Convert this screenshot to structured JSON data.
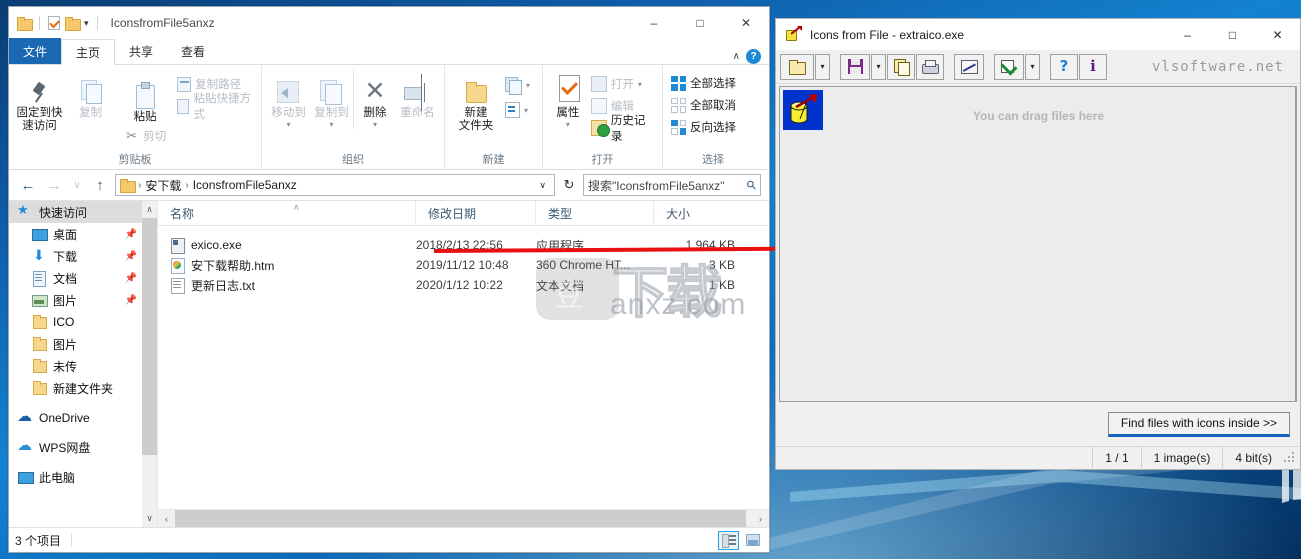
{
  "explorer": {
    "title": "IconsfromFile5anxz",
    "quick_access_toolbar": [
      {
        "name": "folder-icon",
        "label": "文件夹"
      },
      {
        "name": "properties-icon",
        "label": "属性"
      },
      {
        "name": "new-folder-icon",
        "label": "新建文件夹"
      },
      {
        "name": "customize-caret",
        "label": "▾"
      }
    ],
    "window_buttons": {
      "minimize": "–",
      "maximize": "□",
      "close": "✕"
    },
    "tabs": [
      {
        "label": "文件",
        "state": "file"
      },
      {
        "label": "主页",
        "state": "active"
      },
      {
        "label": "共享",
        "state": "normal"
      },
      {
        "label": "查看",
        "state": "normal"
      }
    ],
    "ribbon_collapse": "∧",
    "help_label": "?",
    "ribbon": {
      "clipboard": {
        "group_label": "剪贴板",
        "pin": "固定到快速访问",
        "pin_line1": "固定到快",
        "pin_line2": "速访问",
        "copy": "复制",
        "paste": "粘贴",
        "cut": "剪切",
        "copy_path": "复制路径",
        "paste_shortcut": "粘贴快捷方式"
      },
      "organize": {
        "group_label": "组织",
        "move_to": "移动到",
        "copy_to": "复制到",
        "delete": "删除",
        "rename": "重命名"
      },
      "new": {
        "group_label": "新建",
        "new_folder_line1": "新建",
        "new_folder_line2": "文件夹"
      },
      "open": {
        "group_label": "打开",
        "properties": "属性",
        "open": "打开",
        "edit": "编辑",
        "history": "历史记录"
      },
      "select": {
        "group_label": "选择",
        "select_all": "全部选择",
        "select_none": "全部取消",
        "invert": "反向选择"
      }
    },
    "address": {
      "back": "←",
      "forward": "→",
      "recent": "∨",
      "up": "↑",
      "crumbs": [
        "安下载",
        "IconsfromFile5anxz"
      ],
      "separator": "›",
      "dropdown": "∨",
      "refresh": "↻"
    },
    "search": {
      "value": "搜索\"IconsfromFile5anxz\"",
      "icon": "⚲"
    },
    "nav_pane": [
      {
        "label": "快速访问",
        "icon": "star-icon",
        "level": 0,
        "selected": true,
        "pinned": false
      },
      {
        "label": "桌面",
        "icon": "desktop-icon",
        "level": 1,
        "selected": false,
        "pinned": true
      },
      {
        "label": "下载",
        "icon": "download-icon",
        "level": 1,
        "selected": false,
        "pinned": true
      },
      {
        "label": "文档",
        "icon": "document-icon",
        "level": 1,
        "selected": false,
        "pinned": true
      },
      {
        "label": "图片",
        "icon": "picture-icon",
        "level": 1,
        "selected": false,
        "pinned": true
      },
      {
        "label": "ICO",
        "icon": "folder-icon",
        "level": 1,
        "selected": false,
        "pinned": false
      },
      {
        "label": "图片",
        "icon": "folder-icon",
        "level": 1,
        "selected": false,
        "pinned": false
      },
      {
        "label": "未传",
        "icon": "folder-icon",
        "level": 1,
        "selected": false,
        "pinned": false
      },
      {
        "label": "新建文件夹",
        "icon": "folder-icon",
        "level": 1,
        "selected": false,
        "pinned": false
      },
      {
        "label": "OneDrive",
        "icon": "onedrive-icon",
        "level": 0,
        "selected": false,
        "pinned": false
      },
      {
        "label": "WPS网盘",
        "icon": "wps-cloud-icon",
        "level": 0,
        "selected": false,
        "pinned": false
      },
      {
        "label": "此电脑",
        "icon": "this-pc-icon",
        "level": 0,
        "selected": false,
        "pinned": false
      }
    ],
    "columns": [
      {
        "key": "name",
        "label": "名称",
        "sorted": true,
        "sort_caret": "∧"
      },
      {
        "key": "date",
        "label": "修改日期"
      },
      {
        "key": "type",
        "label": "类型"
      },
      {
        "key": "size",
        "label": "大小"
      }
    ],
    "files": [
      {
        "name": "exico.exe",
        "icon": "exe-file-icon",
        "date": "2018/2/13 22:56",
        "type": "应用程序",
        "size": "1,964 KB"
      },
      {
        "name": "安下载帮助.htm",
        "icon": "html-file-icon",
        "date": "2019/11/12 10:48",
        "type": "360 Chrome HT...",
        "size": "3 KB"
      },
      {
        "name": "更新日志.txt",
        "icon": "text-file-icon",
        "date": "2020/1/12 10:22",
        "type": "文本文档",
        "size": "1 KB"
      }
    ],
    "watermark": {
      "badge_glyph": "豆",
      "outline_text": "下载",
      "domain_text": "anxz.com"
    },
    "status": {
      "item_count": "3 个项目"
    },
    "view_buttons": [
      {
        "name": "details-view-button",
        "active": true
      },
      {
        "name": "thumbnail-view-button",
        "active": false
      }
    ],
    "hscroll": {
      "left": "‹",
      "right": "›"
    },
    "vscroll": {
      "up": "∨",
      "down": "∨"
    }
  },
  "extraico": {
    "title": "Icons from File - extraico.exe",
    "window_buttons": {
      "minimize": "–",
      "maximize": "□",
      "close": "✕"
    },
    "toolbar": [
      {
        "name": "open-file-button",
        "glyph": "open-folder-icon"
      },
      {
        "name": "open-dropdown-button",
        "glyph": "caret-down-icon",
        "label": "▾"
      },
      {
        "name": "save-button",
        "glyph": "floppy-save-icon"
      },
      {
        "name": "save-dropdown-button",
        "glyph": "caret-down-icon",
        "label": "▾"
      },
      {
        "name": "copy-button",
        "glyph": "copy-icon"
      },
      {
        "name": "print-button",
        "glyph": "printer-icon"
      },
      {
        "name": "preview-button",
        "glyph": "chart-preview-icon"
      },
      {
        "name": "select-all-button",
        "glyph": "green-check-icon"
      },
      {
        "name": "select-dropdown-button",
        "glyph": "caret-down-icon",
        "label": "▾"
      },
      {
        "name": "help-button",
        "glyph": "question-mark-icon",
        "label": "?"
      },
      {
        "name": "about-button",
        "glyph": "info-icon",
        "label": "i"
      }
    ],
    "brand": "vlsoftware.net",
    "drag_hint": "You can drag files here",
    "find_button": "Find files with icons inside >>",
    "status": {
      "page": "1 / 1",
      "images": "1 image(s)",
      "depth": "4 bit(s)"
    }
  },
  "annotation": {
    "arrow_color": "#e81010",
    "arrow_name": "red-pointer-arrow"
  }
}
